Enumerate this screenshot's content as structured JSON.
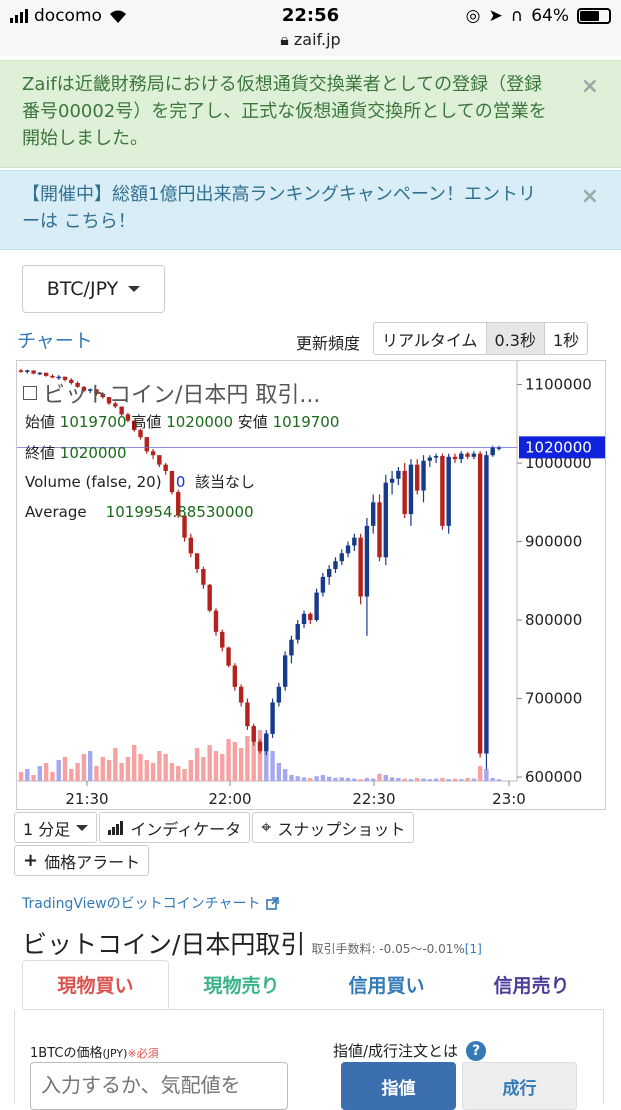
{
  "status_bar": {
    "carrier": "docomo",
    "time": "22:56",
    "url": "zaif.jp",
    "battery": "64%"
  },
  "alerts": [
    {
      "text": "Zaifは近畿財務局における仮想通貨交換業者としての登録（登録番号00002号）を完了し、正式な仮想通貨交換所としての営業を開始しました。",
      "close": "×"
    },
    {
      "text": "【開催中】総額1億円出来高ランキングキャンペーン！エントリーは こちら！",
      "close": "×"
    }
  ],
  "pair_select": {
    "label": "BTC/JPY"
  },
  "chart_header": {
    "chart_link": "チャート",
    "freq_label": "更新頻度",
    "freq_options": [
      "リアルタイム",
      "0.3秒",
      "1秒"
    ],
    "freq_selected": "0.3秒"
  },
  "chart_overlay": {
    "title": "ビットコイン/日本円 取引...",
    "open_label": "始値",
    "open": "1019700",
    "high_label": "高値",
    "high": "1020000",
    "low_label": "安値",
    "low": "1019700",
    "close_label": "終値",
    "close": "1020000",
    "volume_label": "Volume (false, 20)",
    "volume_value": "0",
    "volume_note": "該当なし",
    "average_label": "Average",
    "average_value": "1019954.88530000"
  },
  "chart_data": {
    "type": "candlestick",
    "y_ticks": [
      "1100000",
      "1000000",
      "900000",
      "800000",
      "700000",
      "600000"
    ],
    "ylim": [
      595000,
      1130000
    ],
    "x_ticks": [
      "21:30",
      "22:00",
      "22:30",
      "23:0"
    ],
    "current_price_label": "1020000",
    "current_price": 1020000,
    "colors": {
      "up": "#173a8a",
      "down": "#b3221d",
      "vol_up": "#a6a8ef",
      "vol_down": "#f6a2a2",
      "price_line": "#6c6cd8",
      "price_badge": "#1122dd"
    },
    "candles": [
      [
        1118000,
        1120000,
        1115000,
        1117000
      ],
      [
        1117000,
        1119000,
        1114000,
        1118000
      ],
      [
        1118000,
        1118000,
        1113000,
        1114000
      ],
      [
        1114000,
        1116000,
        1112000,
        1115000
      ],
      [
        1115000,
        1115000,
        1110000,
        1111000
      ],
      [
        1111000,
        1113000,
        1108000,
        1109000
      ],
      [
        1109000,
        1112000,
        1106000,
        1110000
      ],
      [
        1110000,
        1110000,
        1104000,
        1106000
      ],
      [
        1106000,
        1108000,
        1100000,
        1102000
      ],
      [
        1102000,
        1104000,
        1096000,
        1097000
      ],
      [
        1097000,
        1098000,
        1090000,
        1092000
      ],
      [
        1092000,
        1095000,
        1089000,
        1094000
      ],
      [
        1094000,
        1094000,
        1086000,
        1088000
      ],
      [
        1088000,
        1090000,
        1082000,
        1084000
      ],
      [
        1084000,
        1084000,
        1074000,
        1076000
      ],
      [
        1076000,
        1078000,
        1070000,
        1072000
      ],
      [
        1072000,
        1072000,
        1060000,
        1062000
      ],
      [
        1062000,
        1064000,
        1052000,
        1054000
      ],
      [
        1054000,
        1054000,
        1040000,
        1042000
      ],
      [
        1042000,
        1044000,
        1030000,
        1033000
      ],
      [
        1033000,
        1033000,
        1012000,
        1015000
      ],
      [
        1015000,
        1018000,
        1005000,
        1010000
      ],
      [
        1010000,
        1010000,
        995000,
        998000
      ],
      [
        998000,
        1000000,
        985000,
        990000
      ],
      [
        990000,
        990000,
        960000,
        963000
      ],
      [
        963000,
        966000,
        930000,
        933000
      ],
      [
        933000,
        933000,
        900000,
        905000
      ],
      [
        905000,
        910000,
        880000,
        885000
      ],
      [
        885000,
        885000,
        860000,
        865000
      ],
      [
        865000,
        868000,
        840000,
        845000
      ],
      [
        845000,
        846000,
        810000,
        812000
      ],
      [
        812000,
        815000,
        780000,
        785000
      ],
      [
        785000,
        788000,
        760000,
        765000
      ],
      [
        765000,
        766000,
        740000,
        742000
      ],
      [
        742000,
        745000,
        710000,
        715000
      ],
      [
        715000,
        718000,
        690000,
        695000
      ],
      [
        695000,
        700000,
        660000,
        665000
      ],
      [
        665000,
        668000,
        640000,
        645000
      ],
      [
        645000,
        648000,
        630000,
        633000
      ],
      [
        633000,
        660000,
        628000,
        655000
      ],
      [
        655000,
        700000,
        650000,
        695000
      ],
      [
        695000,
        720000,
        690000,
        715000
      ],
      [
        715000,
        760000,
        710000,
        755000
      ],
      [
        755000,
        780000,
        745000,
        775000
      ],
      [
        775000,
        800000,
        770000,
        795000
      ],
      [
        795000,
        812000,
        790000,
        808000
      ],
      [
        808000,
        810000,
        795000,
        800000
      ],
      [
        800000,
        840000,
        798000,
        835000
      ],
      [
        835000,
        860000,
        830000,
        855000
      ],
      [
        855000,
        870000,
        845000,
        865000
      ],
      [
        865000,
        880000,
        860000,
        875000
      ],
      [
        875000,
        890000,
        870000,
        885000
      ],
      [
        885000,
        900000,
        880000,
        895000
      ],
      [
        895000,
        910000,
        888000,
        905000
      ],
      [
        905000,
        910000,
        820000,
        830000
      ],
      [
        830000,
        930000,
        780000,
        920000
      ],
      [
        920000,
        960000,
        910000,
        950000
      ],
      [
        950000,
        960000,
        875000,
        880000
      ],
      [
        880000,
        985000,
        870000,
        975000
      ],
      [
        975000,
        990000,
        960000,
        980000
      ],
      [
        980000,
        995000,
        972000,
        990000
      ],
      [
        990000,
        1000000,
        930000,
        935000
      ],
      [
        935000,
        1005000,
        920000,
        998000
      ],
      [
        998000,
        1005000,
        960000,
        965000
      ],
      [
        965000,
        1010000,
        950000,
        1003000
      ],
      [
        1003000,
        1010000,
        995000,
        1007000
      ],
      [
        1007000,
        1012000,
        1000000,
        1009000
      ],
      [
        1009000,
        1012000,
        915000,
        920000
      ],
      [
        920000,
        1012000,
        910000,
        1008000
      ],
      [
        1008000,
        1012000,
        1000000,
        1005000
      ],
      [
        1005000,
        1015000,
        1000000,
        1012000
      ],
      [
        1012000,
        1014000,
        1005000,
        1008000
      ],
      [
        1008000,
        1015000,
        1005000,
        1012000
      ],
      [
        1012000,
        1015000,
        625000,
        630000
      ],
      [
        630000,
        1015000,
        610000,
        1010000
      ],
      [
        1010000,
        1022000,
        1008000,
        1020000
      ],
      [
        1020000,
        1022000,
        1016000,
        1020000
      ]
    ],
    "volumes": [
      0.15,
      0.2,
      0.1,
      0.25,
      0.3,
      0.15,
      0.35,
      0.4,
      0.2,
      0.3,
      0.45,
      0.5,
      0.25,
      0.4,
      0.35,
      0.55,
      0.3,
      0.4,
      0.6,
      0.45,
      0.35,
      0.3,
      0.5,
      0.45,
      0.3,
      0.25,
      0.2,
      0.35,
      0.55,
      0.4,
      0.6,
      0.5,
      0.45,
      0.7,
      0.65,
      0.55,
      0.75,
      0.9,
      0.85,
      0.8,
      0.5,
      0.3,
      0.2,
      0.1,
      0.08,
      0.06,
      0.05,
      0.08,
      0.1,
      0.07,
      0.05,
      0.06,
      0.05,
      0.04,
      0.03,
      0.05,
      0.04,
      0.12,
      0.1,
      0.06,
      0.05,
      0.04,
      0.03,
      0.05,
      0.04,
      0.03,
      0.04,
      0.05,
      0.03,
      0.04,
      0.03,
      0.05,
      0.04,
      0.25,
      0.2,
      0.05,
      0.03
    ]
  },
  "chart_toolbar": {
    "interval": "1 分足",
    "indicator": "インディケータ",
    "snapshot": "スナップショット",
    "price_alert": "価格アラート"
  },
  "tradingview_link": "TradingViewのビットコインチャート",
  "trade": {
    "title": "ビットコイン/日本円取引",
    "fee_note": "取引手数料: -0.05〜-0.01%",
    "fee_ref": "[1]",
    "tabs": [
      {
        "label": "現物買い",
        "color": "#d9534f"
      },
      {
        "label": "現物売り",
        "color": "#3cb38a"
      },
      {
        "label": "信用買い",
        "color": "#337ab7"
      },
      {
        "label": "信用売り",
        "color": "#4d3d99"
      }
    ],
    "price_label": "1BTCの価格",
    "price_unit": "(JPY)",
    "price_required": "※必須",
    "price_placeholder": "入力するか、気配値を",
    "order_type_label": "指値/成行注文とは",
    "order_limit": "指値",
    "order_market": "成行"
  }
}
